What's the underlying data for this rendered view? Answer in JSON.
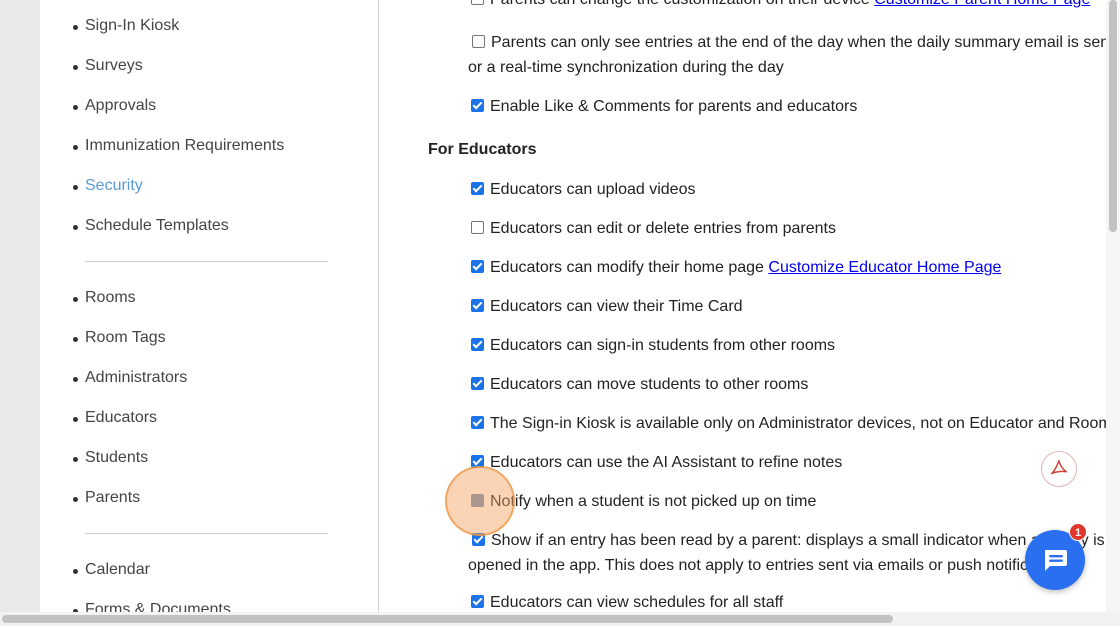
{
  "sidebar": {
    "items": [
      {
        "label": "Sign-In Kiosk"
      },
      {
        "label": "Surveys"
      },
      {
        "label": "Approvals"
      },
      {
        "label": "Immunization Requirements"
      },
      {
        "label": "Security",
        "active": true
      },
      {
        "label": "Schedule Templates"
      },
      {
        "label": "Rooms"
      },
      {
        "label": "Room Tags"
      },
      {
        "label": "Administrators"
      },
      {
        "label": "Educators"
      },
      {
        "label": "Students"
      },
      {
        "label": "Parents"
      },
      {
        "label": "Calendar"
      },
      {
        "label": "Forms & Documents"
      }
    ]
  },
  "parents": {
    "customize": {
      "label": "Parents can change the customization on their device",
      "link": "Customize Parent Home Page",
      "checked": false
    },
    "end_of_day": {
      "label": "Parents can only see entries at the end of the day when the daily summary email is sent, or a real-time synchronization during the day",
      "checked": false
    },
    "like_comments": {
      "label": "Enable Like & Comments for parents and educators",
      "checked": true
    }
  },
  "educators": {
    "title": "For Educators",
    "upload_videos": {
      "label": "Educators can upload videos",
      "checked": true
    },
    "edit_delete": {
      "label": "Educators can edit or delete entries from parents",
      "checked": false
    },
    "modify_home": {
      "label": "Educators can modify their home page",
      "link": "Customize Educator Home Page",
      "checked": true
    },
    "time_card": {
      "label": "Educators can view their Time Card",
      "checked": true
    },
    "sign_in_other": {
      "label": "Educators can sign-in students from other rooms",
      "checked": true
    },
    "move_students": {
      "label": "Educators can move students to other rooms",
      "checked": true
    },
    "kiosk_admin": {
      "label": "The Sign-in Kiosk is available only on Administrator devices, not on Educator and Room devic",
      "checked": true
    },
    "ai_assistant": {
      "label": "Educators can use the AI Assistant to refine notes",
      "checked": true
    },
    "not_picked_up": {
      "label": "Notify when a student is not picked up on time",
      "checked": true
    },
    "read_indicator": {
      "label": "Show if an entry has been read by a parent: displays a small indicator when an entry is opened in the app. This does not apply to entries sent via emails or push notifications.",
      "checked": true
    },
    "schedules": {
      "label": "Educators can view schedules for all staff",
      "checked": true
    }
  },
  "widgets": {
    "pdf_icon": "pdf-icon",
    "chat_icon": "chat-icon",
    "chat_badge": "1"
  },
  "colors": {
    "accent": "#5a9bd5",
    "checkbox": "#1a73e8",
    "link": "#0000ee",
    "chat": "#2a6ff0",
    "badge": "#e0362c",
    "highlight": "#f5a05a"
  }
}
